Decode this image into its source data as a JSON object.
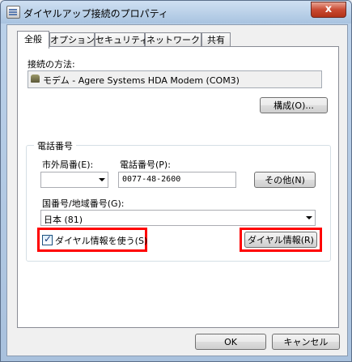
{
  "window": {
    "title": "ダイヤルアップ接続のプロパティ",
    "close_glyph": "x"
  },
  "tabs": [
    {
      "label": "全般",
      "active": true
    },
    {
      "label": "オプション",
      "active": false
    },
    {
      "label": "セキュリティ",
      "active": false
    },
    {
      "label": "ネットワーク",
      "active": false
    },
    {
      "label": "共有",
      "active": false
    }
  ],
  "general": {
    "connect_using_label": "接続の方法:",
    "device_name": "モデム - Agere Systems HDA Modem (COM3)",
    "configure_button": "構成(O)...",
    "phone_group_title": "電話番号",
    "area_code_label": "市外局番(E):",
    "area_code_value": "",
    "phone_number_label": "電話番号(P):",
    "phone_number_value": "0077-48-2600",
    "alternates_button": "その他(N)",
    "country_label": "国番号/地域番号(G):",
    "country_value": "日本 (81)",
    "use_dialing_rules_label": "ダイヤル情報を使う(S)",
    "use_dialing_rules_checked": true,
    "dialing_rules_button": "ダイヤル情報(R)"
  },
  "footer": {
    "ok_button": "OK",
    "cancel_button": "キャンセル"
  },
  "colors": {
    "highlight": "#ff0000",
    "close_button": "#c94a32"
  }
}
